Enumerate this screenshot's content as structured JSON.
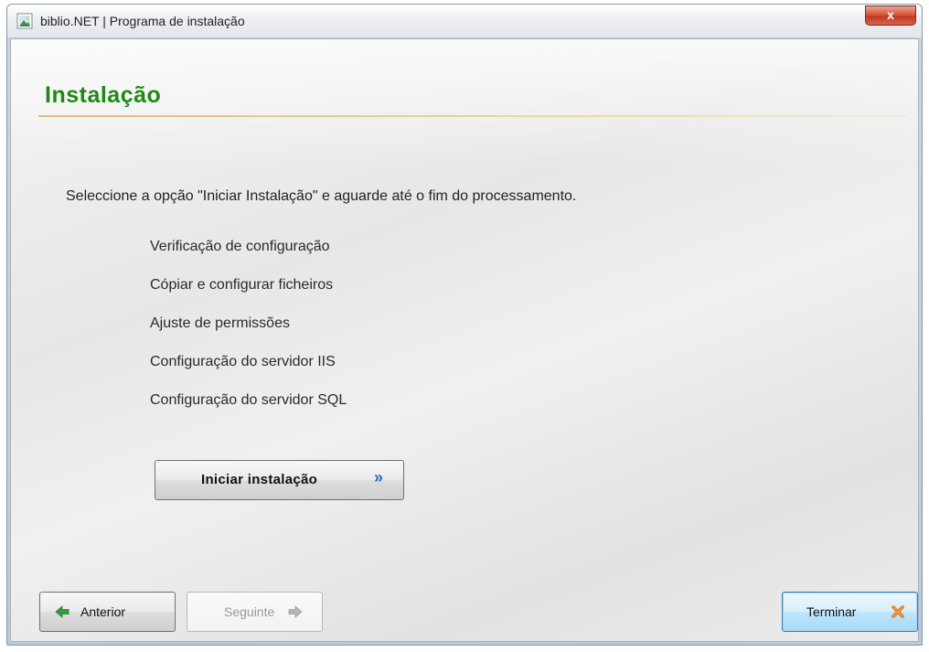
{
  "window": {
    "title": "biblio.NET | Programa de instalação",
    "close_label": "x"
  },
  "page": {
    "title": "Instalação",
    "instruction": "Seleccione a opção \"Iniciar Instalação\" e aguarde até o fim do processamento.",
    "steps": [
      "Verificação de configuração",
      "Cópiar e configurar ficheiros",
      "Ajuste de permissões",
      "Configuração do servidor IIS",
      "Configuração do servidor SQL"
    ],
    "start_button": "Iniciar instalação",
    "start_chevron": "»"
  },
  "footer": {
    "prev_label": "Anterior",
    "next_label": "Seguinte",
    "finish_label": "Terminar"
  },
  "icons": {
    "app": "application-icon",
    "prev": "green-arrow-left-icon",
    "next": "gray-arrow-right-icon",
    "finish": "orange-x-icon"
  },
  "colors": {
    "title_green": "#1e8a13",
    "chevron_blue": "#2a66c9",
    "arrow_green": "#3a9a3a",
    "finish_x_orange": "#e0701a"
  }
}
